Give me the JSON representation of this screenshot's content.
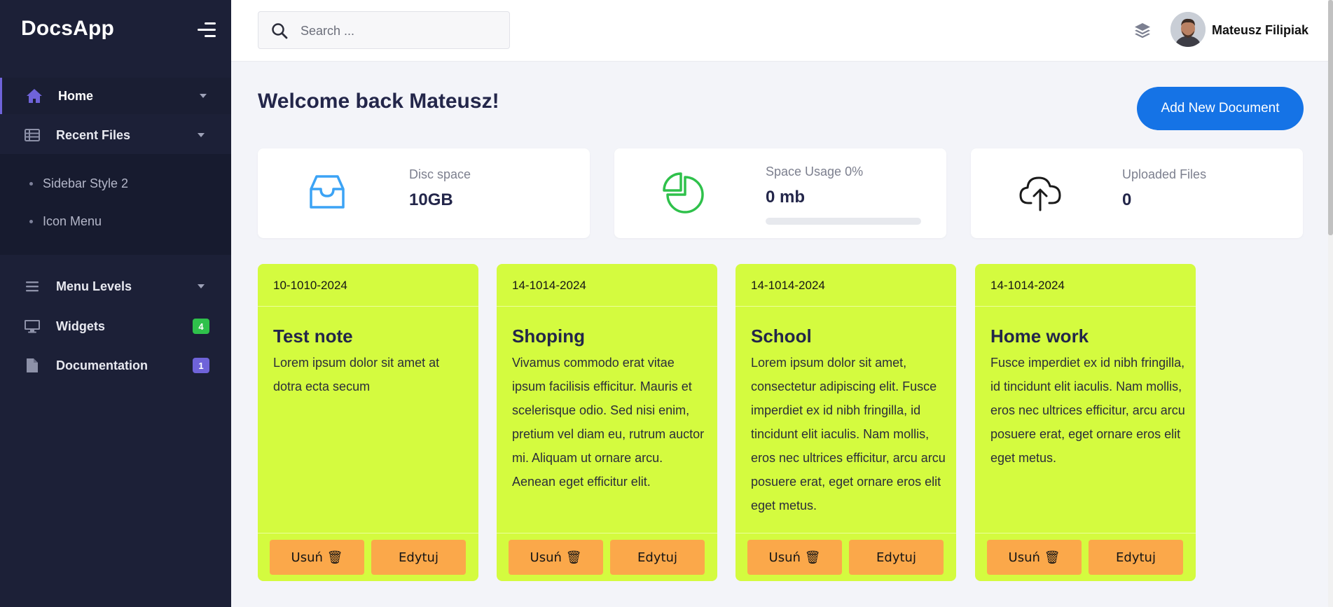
{
  "sidebar": {
    "brand": "DocsApp",
    "items": [
      {
        "label": "Home",
        "icon": "home-icon"
      },
      {
        "label": "Recent Files",
        "icon": "table-icon"
      },
      {
        "label": "Menu Levels",
        "icon": "bars-icon"
      },
      {
        "label": "Widgets",
        "icon": "monitor-icon",
        "badge": "4"
      },
      {
        "label": "Documentation",
        "icon": "file-icon",
        "badge": "1"
      }
    ],
    "submenu": [
      "Sidebar Style 2",
      "Icon Menu"
    ]
  },
  "header": {
    "search_placeholder": "Search ...",
    "user_name": "Mateusz Filipiak"
  },
  "main": {
    "welcome": "Welcome back Mateusz!",
    "add_button": "Add New Document",
    "stats": [
      {
        "label": "Disc space",
        "value": "10GB",
        "icon": "inbox-icon"
      },
      {
        "label": "Space Usage 0%",
        "value": "0 mb",
        "icon": "pie-chart-icon",
        "progress_percent": 0
      },
      {
        "label": "Uploaded Files",
        "value": "0",
        "icon": "cloud-upload-icon"
      }
    ],
    "notes": [
      {
        "date": "10-1010-2024",
        "title": "Test note",
        "body": "Lorem ipsum dolor sit amet at dotra ecta secum",
        "delete_label": "Usuń 🗑",
        "edit_label": "Edytuj"
      },
      {
        "date": "14-1014-2024",
        "title": "Shoping",
        "body": "Vivamus commodo erat vitae ipsum facilisis efficitur. Mauris et scelerisque odio. Sed nisi enim, pretium vel diam eu, rutrum auctor mi. Aliquam ut ornare arcu. Aenean eget efficitur elit.",
        "delete_label": "Usuń 🗑",
        "edit_label": "Edytuj"
      },
      {
        "date": "14-1014-2024",
        "title": "School",
        "body": "Lorem ipsum dolor sit amet, consectetur adipiscing elit. Fusce imperdiet ex id nibh fringilla, id tincidunt elit iaculis. Nam mollis, eros nec ultrices efficitur, arcu arcu posuere erat, eget ornare eros elit eget metus.",
        "delete_label": "Usuń 🗑",
        "edit_label": "Edytuj"
      },
      {
        "date": "14-1014-2024",
        "title": "Home work",
        "body": "Fusce imperdiet ex id nibh fringilla, id tincidunt elit iaculis. Nam mollis, eros nec ultrices efficitur, arcu arcu posuere erat, eget ornare eros elit eget metus.",
        "delete_label": "Usuń 🗑",
        "edit_label": "Edytuj"
      }
    ]
  },
  "colors": {
    "sidebar_bg": "#1c2037",
    "accent_purple": "#6f63d9",
    "primary_blue": "#1573e6",
    "note_bg": "#d4fb3f",
    "note_button": "#fba84a",
    "badge_green": "#2fc14b",
    "badge_purple": "#6f63d9"
  }
}
